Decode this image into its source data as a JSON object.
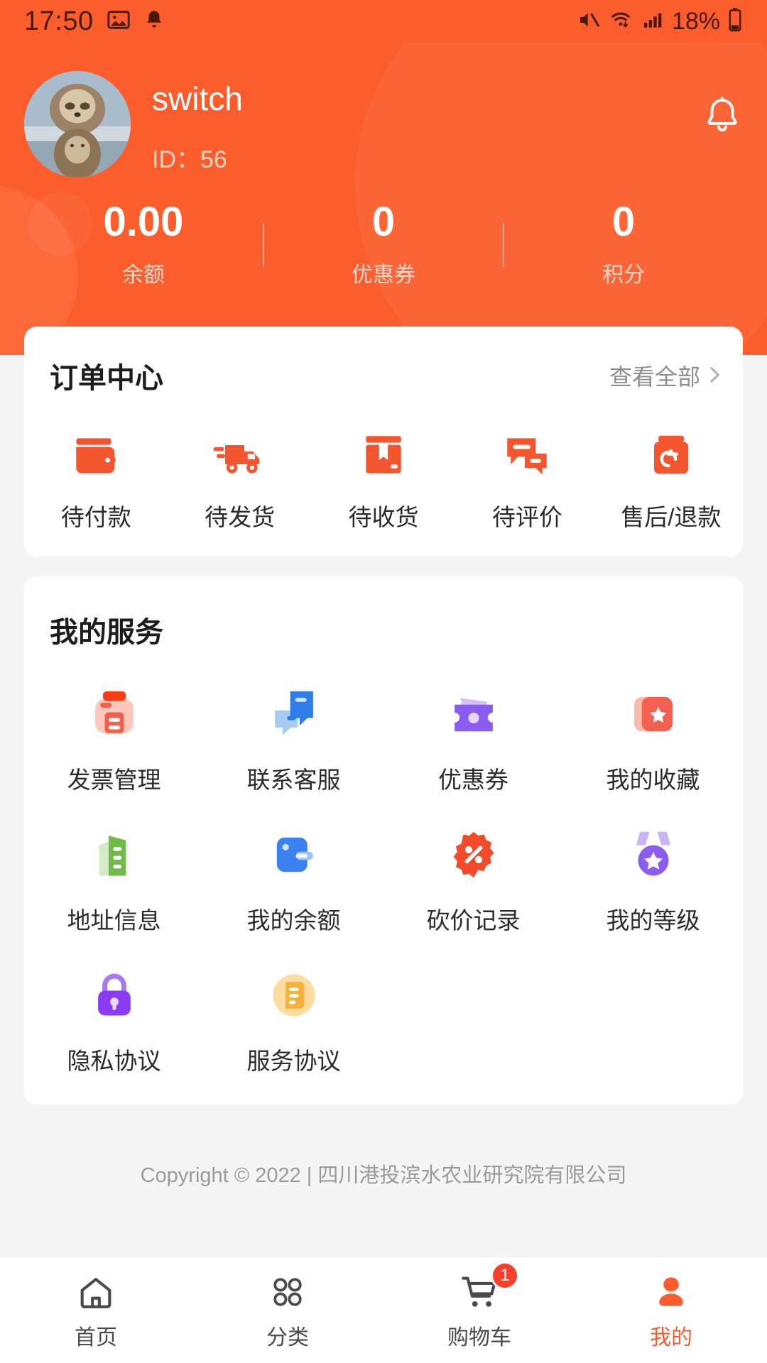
{
  "status_bar": {
    "time": "17:50",
    "battery_text": "18%",
    "icons": [
      "image-icon",
      "bell-icon",
      "mute-icon",
      "wifi-icon",
      "signal-icon",
      "battery-icon"
    ]
  },
  "header": {
    "username": "switch",
    "user_id": "ID：56",
    "avatar_alt": "sloth-avatar",
    "notification_icon": "bell-icon",
    "accent_color": "#fb5d2c",
    "stats": [
      {
        "value": "0.00",
        "label": "余额"
      },
      {
        "value": "0",
        "label": "优惠券"
      },
      {
        "value": "0",
        "label": "积分"
      }
    ]
  },
  "order_center": {
    "title": "订单中心",
    "more_label": "查看全部",
    "items": [
      {
        "label": "待付款",
        "icon": "wallet-icon"
      },
      {
        "label": "待发货",
        "icon": "truck-icon"
      },
      {
        "label": "待收货",
        "icon": "package-icon"
      },
      {
        "label": "待评价",
        "icon": "comment-icon"
      },
      {
        "label": "售后/退款",
        "icon": "refund-icon"
      }
    ]
  },
  "services": {
    "title": "我的服务",
    "items": [
      {
        "label": "发票管理",
        "icon": "invoice-icon",
        "color": "#fa5a3c"
      },
      {
        "label": "联系客服",
        "icon": "customer-service-icon",
        "color": "#3b82f0"
      },
      {
        "label": "优惠券",
        "icon": "coupon-icon",
        "color": "#8b5cf2"
      },
      {
        "label": "我的收藏",
        "icon": "star-folder-icon",
        "color": "#f2604f"
      },
      {
        "label": "地址信息",
        "icon": "address-doc-icon",
        "color": "#6fbb45"
      },
      {
        "label": "我的余额",
        "icon": "balance-wallet-icon",
        "color": "#3b82f0"
      },
      {
        "label": "砍价记录",
        "icon": "discount-badge-icon",
        "color": "#f24b2c"
      },
      {
        "label": "我的等级",
        "icon": "medal-icon",
        "color": "#8b5cf2"
      },
      {
        "label": "隐私协议",
        "icon": "lock-icon",
        "color": "#9b5cf2"
      },
      {
        "label": "服务协议",
        "icon": "agreement-icon",
        "color": "#f2b23c"
      }
    ]
  },
  "footer": {
    "copyright": "Copyright © 2022 | 四川港投滨水农业研究院有限公司"
  },
  "tabbar": {
    "active_color": "#fb5d2c",
    "items": [
      {
        "label": "首页",
        "icon": "home-icon",
        "active": false,
        "badge": ""
      },
      {
        "label": "分类",
        "icon": "grid-icon",
        "active": false,
        "badge": ""
      },
      {
        "label": "购物车",
        "icon": "cart-icon",
        "active": false,
        "badge": "1"
      },
      {
        "label": "我的",
        "icon": "user-icon",
        "active": true,
        "badge": ""
      }
    ]
  }
}
